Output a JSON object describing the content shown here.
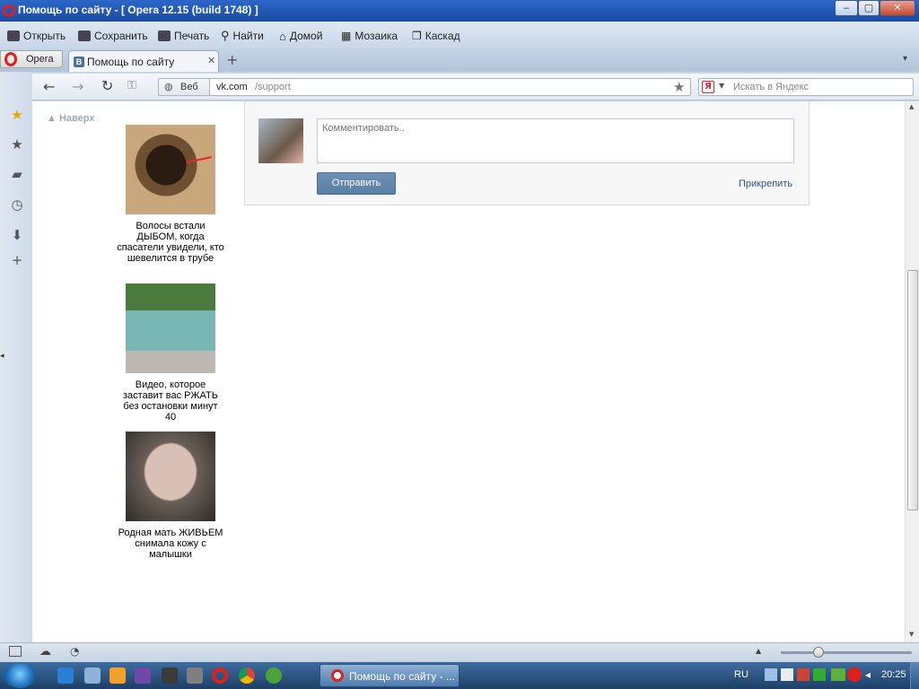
{
  "window": {
    "title": "Помощь по сайту - [ Opera 12.15 (build 1748) ]",
    "controls": {
      "minimize": "‒",
      "maximize": "▢",
      "close": "✕"
    }
  },
  "menu": {
    "items": [
      {
        "label": "Открыть",
        "icon": "folder-icon"
      },
      {
        "label": "Сохранить",
        "icon": "save-icon"
      },
      {
        "label": "Печать",
        "icon": "print-icon"
      },
      {
        "label": "Найти",
        "icon": "find-icon"
      },
      {
        "label": "Домой",
        "icon": "home-icon"
      },
      {
        "label": "Мозаика",
        "icon": "tile-icon"
      },
      {
        "label": "Каскад",
        "icon": "cascade-icon"
      }
    ]
  },
  "tabs": {
    "opera_button": "Opera",
    "active_tab": {
      "label": "Помощь по сайту",
      "favicon": "В"
    },
    "new_tab": "+",
    "close": "✕"
  },
  "nav": {
    "security_label": "Веб",
    "url_domain": "vk.com",
    "url_path": "/support",
    "search_placeholder": "Искать в Яндекс",
    "search_engine": "Я"
  },
  "page": {
    "back_to_top": "Наверх",
    "ads": [
      {
        "text": "Волосы встали ДЫБОМ, когда спасатели увидели, кто шевелится в трубе",
        "color": "#8a6f4f"
      },
      {
        "text": "Видео, которое заставит вас РЖАТЬ без остановки минут 40",
        "color": "#5fa7a7"
      },
      {
        "text": "Родная мать ЖИВЬЕМ снимала кожу с малышки",
        "color": "#6b6b6b"
      }
    ],
    "comment": {
      "placeholder": "Комментировать..",
      "send": "Отправить",
      "attach": "Прикрепить"
    }
  },
  "taskbar": {
    "task_label": "Помощь по сайту - ...",
    "lang": "RU",
    "time": "20:25"
  },
  "colors": {
    "accent": "#5b7fa6",
    "link": "#2b587a",
    "opera_red": "#e0201a"
  }
}
